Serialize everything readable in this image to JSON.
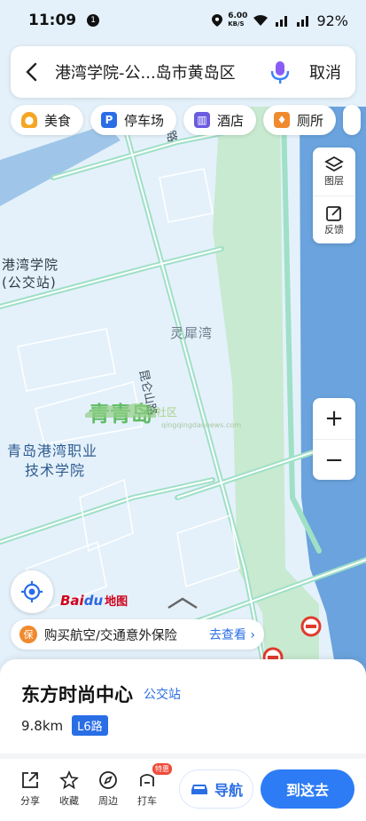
{
  "status": {
    "time": "11:09",
    "notification_count": "1",
    "net_speed": "6.00",
    "net_unit": "KB/S",
    "battery": "92%"
  },
  "search": {
    "query": "港湾学院-公...岛市黄岛区",
    "cancel_label": "取消"
  },
  "categories": [
    {
      "label": "美食",
      "icon": "food-icon",
      "color": "#f5a623"
    },
    {
      "label": "停车场",
      "icon": "parking-icon",
      "color": "#2a6ee6"
    },
    {
      "label": "酒店",
      "icon": "hotel-icon",
      "color": "#6a5be0"
    },
    {
      "label": "厕所",
      "icon": "toilet-icon",
      "color": "#f08a2e"
    }
  ],
  "tools": {
    "layers_label": "图层",
    "feedback_label": "反馈"
  },
  "map": {
    "labels": {
      "station": "港湾学院\n(公交站)",
      "bay": "灵犀湾",
      "college_line1": "青岛港湾职业",
      "college_line2": "技术学院",
      "road": "昆仑山路",
      "road_top": "山路"
    },
    "logo": {
      "bai": "Bai",
      "du": "du",
      "ditu": "地图"
    },
    "watermark": {
      "main": "青青岛",
      "sub": "社区",
      "url": "qingqingdaonews.com"
    }
  },
  "banner": {
    "text": "购买航空/交通意外保险",
    "link": "去查看 ›"
  },
  "place": {
    "name": "东方时尚中心",
    "type": "公交站",
    "distance": "9.8km",
    "line": "L6路"
  },
  "actions": {
    "share": "分享",
    "favorite": "收藏",
    "nearby": "周边",
    "taxi": "打车",
    "taxi_badge": "特惠",
    "navigate": "导航",
    "go_here": "到这去"
  },
  "colors": {
    "accent": "#2d7cf5",
    "water": "#5b9ad9",
    "green": "#bfe5b8"
  }
}
